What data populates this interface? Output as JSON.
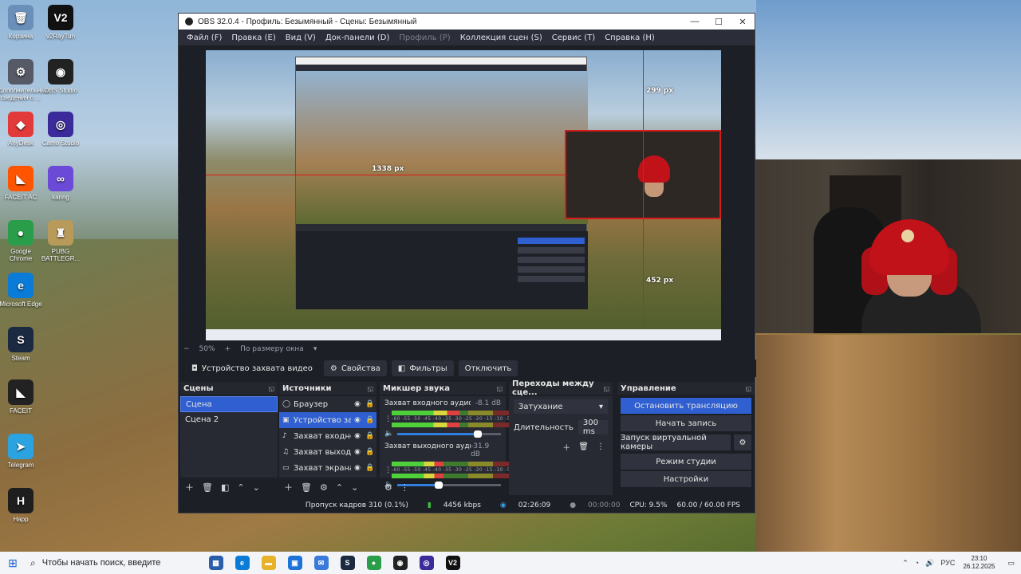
{
  "desktop": {
    "icons": [
      {
        "label": "Корзина",
        "glyph": "🗑",
        "color": "#6a8fb8"
      },
      {
        "label": "Дополнительные сведения о ...",
        "glyph": "⚙",
        "color": "#555a66"
      },
      {
        "label": "AnyDesk",
        "glyph": "◆",
        "color": "#e23a3a"
      },
      {
        "label": "FACEIT AC",
        "glyph": "◣",
        "color": "#ff5500"
      },
      {
        "label": "Google Chrome",
        "glyph": "●",
        "color": "#2a9d4a"
      },
      {
        "label": "Microsoft Edge",
        "glyph": "e",
        "color": "#0a7bd6"
      },
      {
        "label": "Steam",
        "glyph": "S",
        "color": "#1b2a40"
      },
      {
        "label": "FACEIT",
        "glyph": "◣",
        "color": "#222222"
      },
      {
        "label": "Telegram",
        "glyph": "➤",
        "color": "#2aa3e0"
      },
      {
        "label": "Happ",
        "glyph": "H",
        "color": "#1e1e1e"
      },
      {
        "label": "v2RayTun",
        "glyph": "V2",
        "color": "#111111"
      },
      {
        "label": "OBS Studio",
        "glyph": "◉",
        "color": "#222222"
      },
      {
        "label": "Camo Studio",
        "glyph": "◎",
        "color": "#3a2a9a"
      },
      {
        "label": "karing",
        "glyph": "∞",
        "color": "#6a4ad6"
      },
      {
        "label": "PUBG BATTLEGR...",
        "glyph": "♜",
        "color": "#b89a5a"
      }
    ]
  },
  "obs": {
    "title": "OBS 32.0.4 - Профиль: Безымянный - Сцены: Безымянный",
    "window_buttons": {
      "minimize": "—",
      "maximize": "☐",
      "close": "✕"
    },
    "menu": [
      {
        "label": "Файл (F)"
      },
      {
        "label": "Правка (E)"
      },
      {
        "label": "Вид (V)"
      },
      {
        "label": "Док-панели (D)"
      },
      {
        "label": "Профиль (P)"
      },
      {
        "label": "Коллекция сцен (S)"
      },
      {
        "label": "Сервис (T)"
      },
      {
        "label": "Справка (H)"
      }
    ],
    "preview": {
      "measure_width": "1338 px",
      "measure_top": "299 px",
      "measure_bottom": "452 px"
    },
    "zoom": {
      "minus": "−",
      "value": "50%",
      "plus": "+",
      "mode": "По размеру окна"
    },
    "source_toolbar": {
      "source_name": "Устройство захвата видео",
      "properties": "Свойства",
      "filters": "Фильтры",
      "disconnect": "Отключить"
    },
    "scenes": {
      "title": "Сцены",
      "items": [
        "Сцена",
        "Сцена 2"
      ]
    },
    "sources": {
      "title": "Источники",
      "items": [
        {
          "icon": "◯",
          "name": "Браузер"
        },
        {
          "icon": "▣",
          "name": "Устройство захвата видео"
        },
        {
          "icon": "♪",
          "name": "Захват входного аудиопотока"
        },
        {
          "icon": "♫",
          "name": "Захват выходного аудиопотока"
        },
        {
          "icon": "▭",
          "name": "Захват экрана"
        }
      ]
    },
    "mixer": {
      "title": "Микшер звука",
      "channels": [
        {
          "name": "Захват входного аудиопотока",
          "db": "-8.1 dB",
          "level": 0.55,
          "volume": 0.78
        },
        {
          "name": "Захват выходного аудиопотока",
          "db": "-31.9 dB",
          "level": 0.42,
          "volume": 0.4
        }
      ],
      "ticks": "-60 -55 -50 -45 -40 -35 -30 -25 -20 -15 -10 -5 0"
    },
    "transitions": {
      "title": "Переходы между сце...",
      "selected": "Затухание",
      "duration_label": "Длительность",
      "duration_value": "300 ms"
    },
    "controls": {
      "title": "Управление",
      "stop_stream": "Остановить трансляцию",
      "start_record": "Начать запись",
      "virtual_cam": "Запуск виртуальной камеры",
      "studio_mode": "Режим студии",
      "settings": "Настройки"
    },
    "status": {
      "dropped": "Пропуск кадров 310 (0.1%)",
      "bitrate": "4456 kbps",
      "stream_time": "02:26:09",
      "record_time": "00:00:00",
      "cpu": "CPU: 9.5%",
      "fps": "60.00 / 60.00 FPS"
    }
  },
  "taskbar": {
    "search_placeholder": "Чтобы начать поиск, введите",
    "apps": [
      {
        "name": "task-view",
        "glyph": "▦",
        "color": "#2b5ea8"
      },
      {
        "name": "edge",
        "glyph": "e",
        "color": "#0a7bd6"
      },
      {
        "name": "explorer",
        "glyph": "▬",
        "color": "#e8b12a"
      },
      {
        "name": "store",
        "glyph": "▣",
        "color": "#1e73d6"
      },
      {
        "name": "mail",
        "glyph": "✉",
        "color": "#3a7ad8"
      },
      {
        "name": "steam",
        "glyph": "S",
        "color": "#1b2a40"
      },
      {
        "name": "chrome",
        "glyph": "●",
        "color": "#2a9d4a"
      },
      {
        "name": "obs",
        "glyph": "◉",
        "color": "#222222"
      },
      {
        "name": "camo",
        "glyph": "◎",
        "color": "#3a2a9a"
      },
      {
        "name": "v2raytun",
        "glyph": "V2",
        "color": "#111111"
      }
    ],
    "language": "РУС",
    "time": "23:10",
    "date": "26.12.2025"
  }
}
